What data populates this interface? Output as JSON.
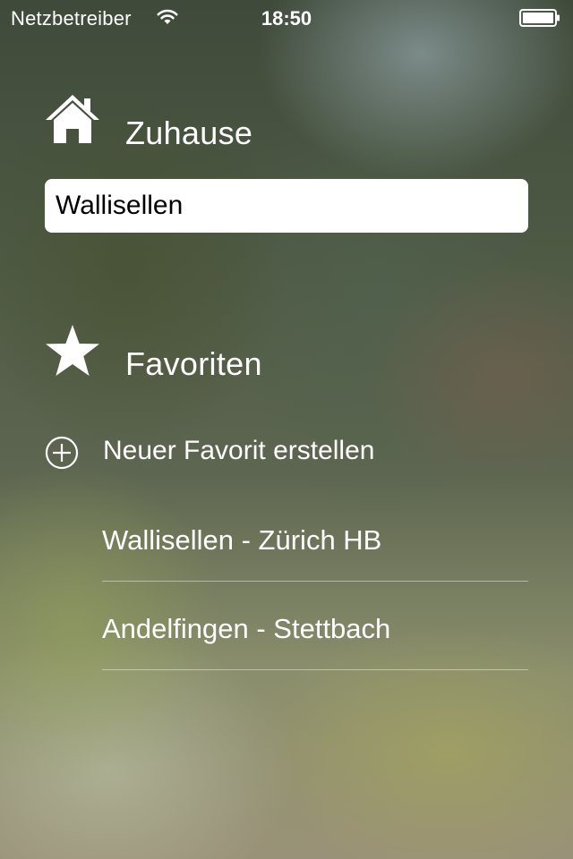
{
  "status_bar": {
    "carrier": "Netzbetreiber",
    "time": "18:50"
  },
  "home": {
    "title": "Zuhause",
    "icon": "house-icon",
    "input_value": "Wallisellen"
  },
  "favorites": {
    "title": "Favoriten",
    "icon": "star-icon",
    "add_label": "Neuer Favorit erstellen",
    "add_icon": "plus-circle-icon",
    "items": [
      {
        "label": "Wallisellen - Zürich HB"
      },
      {
        "label": "Andelfingen - Stettbach"
      }
    ]
  },
  "colors": {
    "text": "#ffffff",
    "input_background": "#ffffff",
    "input_text": "#000000"
  }
}
